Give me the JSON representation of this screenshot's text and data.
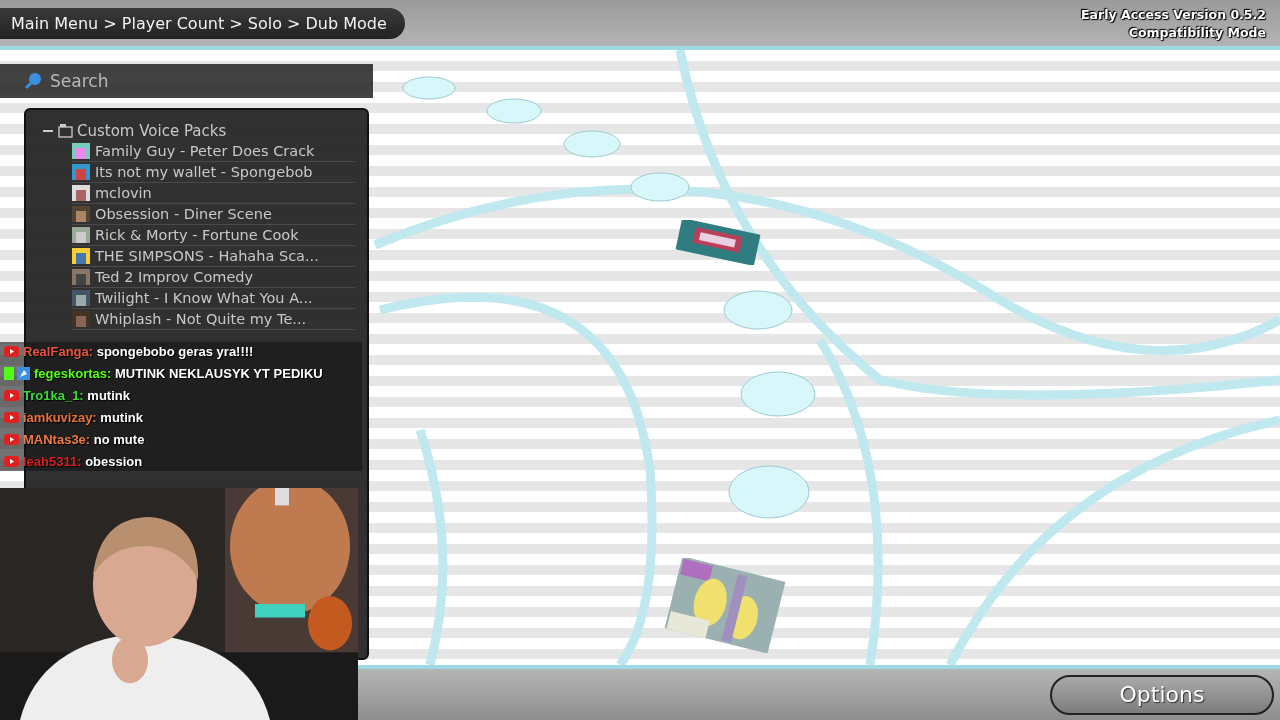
{
  "header": {
    "breadcrumb": "Main Menu > Player Count > Solo > Dub Mode",
    "version": "Early Access Version 0.5.2",
    "mode": "Compatibility Mode"
  },
  "search": {
    "placeholder": "Search"
  },
  "tree": {
    "label": "Custom Voice Packs",
    "expanded": true,
    "items": [
      {
        "label": "Family Guy - Peter Does Crack"
      },
      {
        "label": "Its not my wallet - Spongebob"
      },
      {
        "label": "mclovin"
      },
      {
        "label": "Obsession - Diner Scene"
      },
      {
        "label": "Rick & Morty - Fortune Cook"
      },
      {
        "label": "THE SIMPSONS - Hahaha Sca..."
      },
      {
        "label": "Ted 2 Improv Comedy"
      },
      {
        "label": "Twilight - I Know What You A..."
      },
      {
        "label": "Whiplash - Not Quite my Te..."
      }
    ]
  },
  "chat": [
    {
      "kind": "youtube",
      "user": "RealFanga:",
      "color": "#e8553a",
      "message": "spongebobo geras yra!!!!"
    },
    {
      "kind": "kick",
      "user": "fegeskortas:",
      "color": "#53fc18",
      "message": "MUTINK NEKLAUSYK YT PEDIKU"
    },
    {
      "kind": "youtube",
      "user": "Tro1ka_1:",
      "color": "#3ddc3a",
      "message": "mutink"
    },
    {
      "kind": "youtube",
      "user": "iamkuvizay:",
      "color": "#e8703a",
      "message": "mutink"
    },
    {
      "kind": "youtube",
      "user": "MANtas3e:",
      "color": "#ef7a45",
      "message": "no mute"
    },
    {
      "kind": "youtube",
      "user": "leah5311:",
      "color": "#d42020",
      "message": "obession"
    }
  ],
  "options_button": "Options"
}
